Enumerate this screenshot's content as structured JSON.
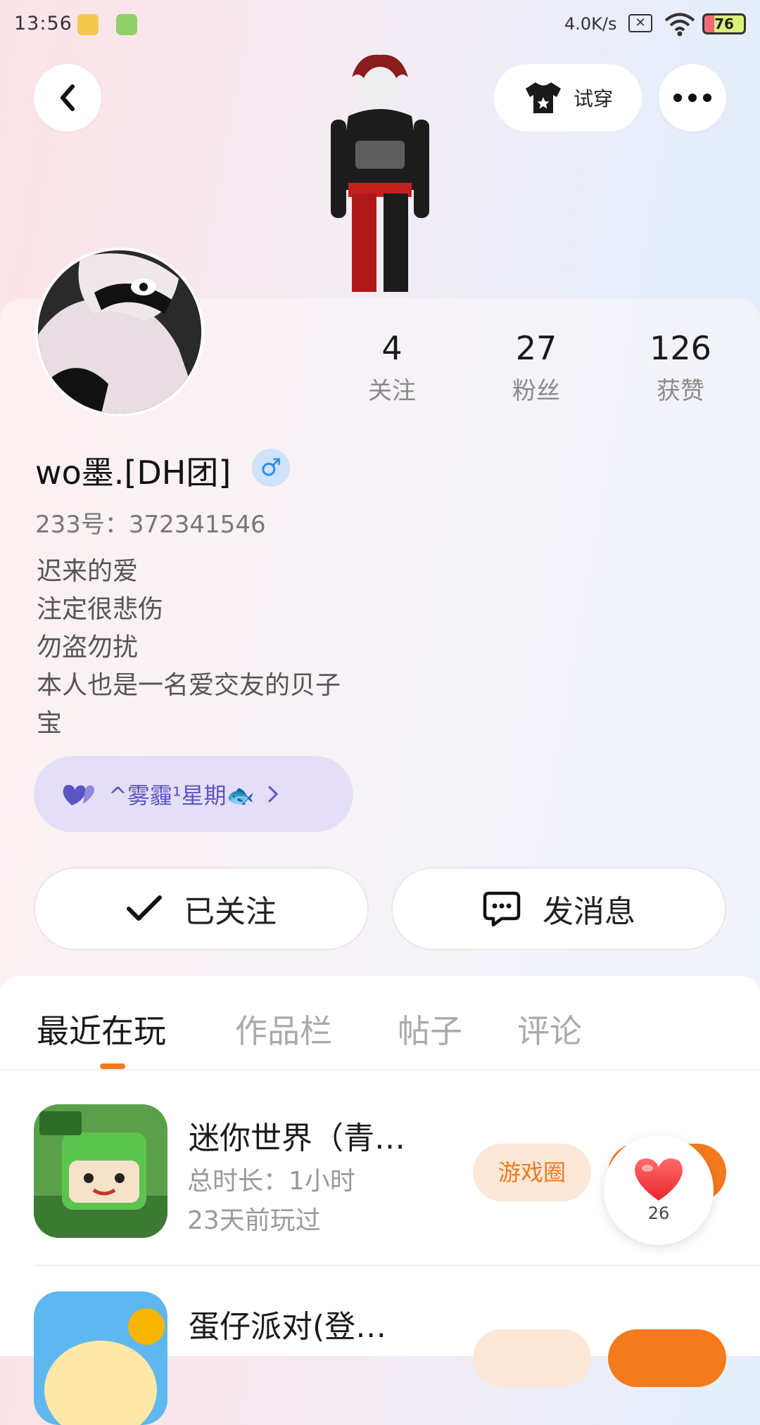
{
  "status_bar": {
    "time": "13:56",
    "net_speed": "4.0K/s",
    "battery": "76"
  },
  "header": {
    "try_on_label": "试穿"
  },
  "profile": {
    "stats": [
      {
        "value": "4",
        "label": "关注"
      },
      {
        "value": "27",
        "label": "粉丝"
      },
      {
        "value": "126",
        "label": "获赞"
      }
    ],
    "username": "wo墨.[DH团]",
    "gender_symbol": "♂",
    "uid": "233号：372341546",
    "bio": [
      "迟来的爱",
      "注定很悲伤",
      "勿盗勿扰",
      "本人也是一名爱交友的贝子",
      "宝"
    ],
    "group": {
      "label": "^雾霾¹星期🐟"
    }
  },
  "actions": {
    "followed_label": "已关注",
    "message_label": "发消息"
  },
  "tabs": [
    {
      "label": "最近在玩",
      "active": true
    },
    {
      "label": "作品栏",
      "active": false
    },
    {
      "label": "帖子",
      "active": false
    },
    {
      "label": "评论",
      "active": false
    }
  ],
  "games": [
    {
      "name": "迷你世界（青…",
      "playtime": "总时长：1小时",
      "last_played": "23天前玩过",
      "circle_label": "游戏圈"
    },
    {
      "name": "蛋仔派对(登…",
      "playtime": "",
      "last_played": "",
      "circle_label": ""
    }
  ],
  "like_widget": {
    "count": "26"
  },
  "colors": {
    "accent": "#f07a1f",
    "gender": "#2b8ef0",
    "group_text": "#5b55c4"
  }
}
